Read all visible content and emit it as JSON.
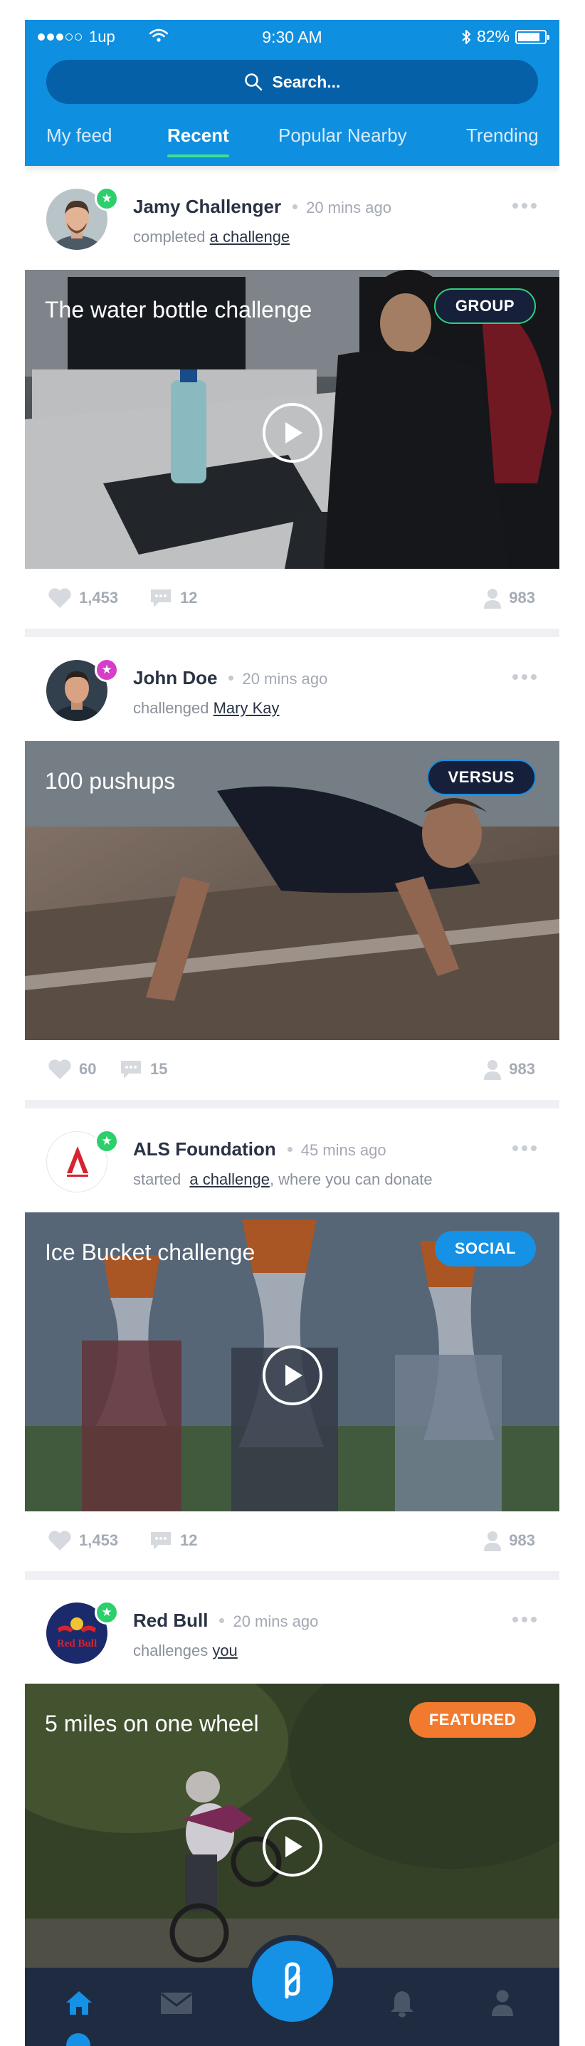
{
  "status_bar": {
    "carrier": "1up",
    "time": "9:30 AM",
    "battery": "82%",
    "battery_level": 0.82,
    "signal_bars": 3
  },
  "search": {
    "placeholder": "Search..."
  },
  "tabs": [
    {
      "label": "My feed",
      "active": false
    },
    {
      "label": "Recent",
      "active": true
    },
    {
      "label": "Popular Nearby",
      "active": false
    },
    {
      "label": "Trending",
      "active": false
    }
  ],
  "posts": [
    {
      "author": "Jamy Challenger",
      "time": "20 mins ago",
      "action_text": "completed",
      "action_link": "a challenge",
      "action_suffix": "",
      "badge_color": "#2dcf6c",
      "title": "The water bottle challenge",
      "tag": "GROUP",
      "has_play": true,
      "likes": "1,453",
      "comments": "12",
      "participants": "983"
    },
    {
      "author": "John Doe",
      "time": "20 mins ago",
      "action_text": "challenged",
      "action_link": "Mary Kay",
      "action_suffix": "",
      "badge_color": "#d63ec9",
      "title": "100 pushups",
      "tag": "VERSUS",
      "has_play": false,
      "likes": "60",
      "comments": "15",
      "participants": "983"
    },
    {
      "author": "ALS Foundation",
      "time": "45 mins ago",
      "action_text": "started",
      "action_link": "a challenge",
      "action_suffix": ", where you can donate",
      "badge_color": "#2dcf6c",
      "title": "Ice Bucket challenge",
      "tag": "SOCIAL",
      "has_play": true,
      "likes": "1,453",
      "comments": "12",
      "participants": "983"
    },
    {
      "author": "Red Bull",
      "time": "20 mins ago",
      "action_text": "challenges",
      "action_link": "you",
      "action_suffix": "",
      "badge_color": "#2dcf6c",
      "title": "5 miles on one wheel",
      "tag": "FEATURED",
      "has_play": true
    }
  ],
  "logos": {
    "red_bull": "Red Bull"
  },
  "icons": {
    "search": "search-icon",
    "wifi": "wifi-icon",
    "bluetooth": "bluetooth-icon",
    "like": "heart-icon",
    "comment": "comment-icon",
    "participants": "person-icon",
    "more": "more-dots-icon",
    "play": "play-icon",
    "home": "home-icon",
    "messages": "envelope-icon",
    "notifications": "bell-icon",
    "profile": "profile-icon"
  },
  "colors": {
    "brand_blue": "#0f8fdf",
    "accent_green": "#3ee08f",
    "nav_dark": "#1f2b40",
    "featured_orange": "#f27a2e"
  }
}
